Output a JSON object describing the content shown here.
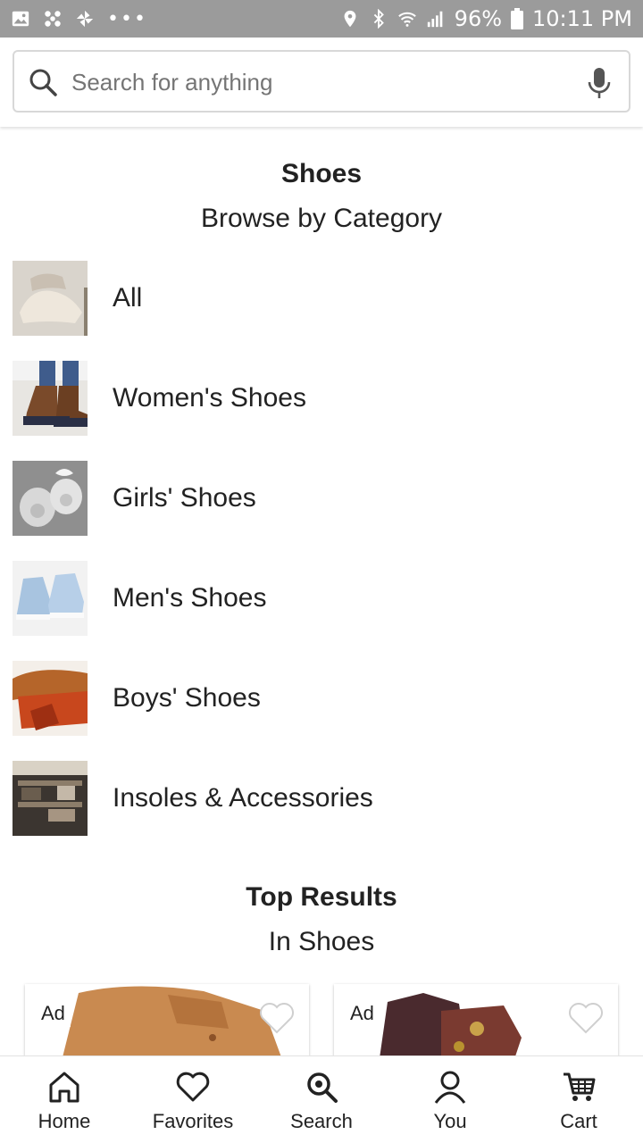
{
  "status_bar": {
    "battery": "96%",
    "time": "10:11 PM"
  },
  "search": {
    "placeholder": "Search for anything"
  },
  "category_section": {
    "title": "Shoes",
    "subtitle": "Browse by Category",
    "items": [
      {
        "label": "All"
      },
      {
        "label": "Women's Shoes"
      },
      {
        "label": "Girls' Shoes"
      },
      {
        "label": "Men's Shoes"
      },
      {
        "label": "Boys' Shoes"
      },
      {
        "label": "Insoles & Accessories"
      }
    ]
  },
  "results_section": {
    "title": "Top Results",
    "subtitle": "In Shoes",
    "cards": [
      {
        "badge": "Ad"
      },
      {
        "badge": "Ad"
      }
    ]
  },
  "bottom_nav": {
    "items": [
      {
        "label": "Home",
        "icon": "home-icon"
      },
      {
        "label": "Favorites",
        "icon": "heart-icon"
      },
      {
        "label": "Search",
        "icon": "search-icon"
      },
      {
        "label": "You",
        "icon": "user-icon"
      },
      {
        "label": "Cart",
        "icon": "cart-icon"
      }
    ]
  }
}
